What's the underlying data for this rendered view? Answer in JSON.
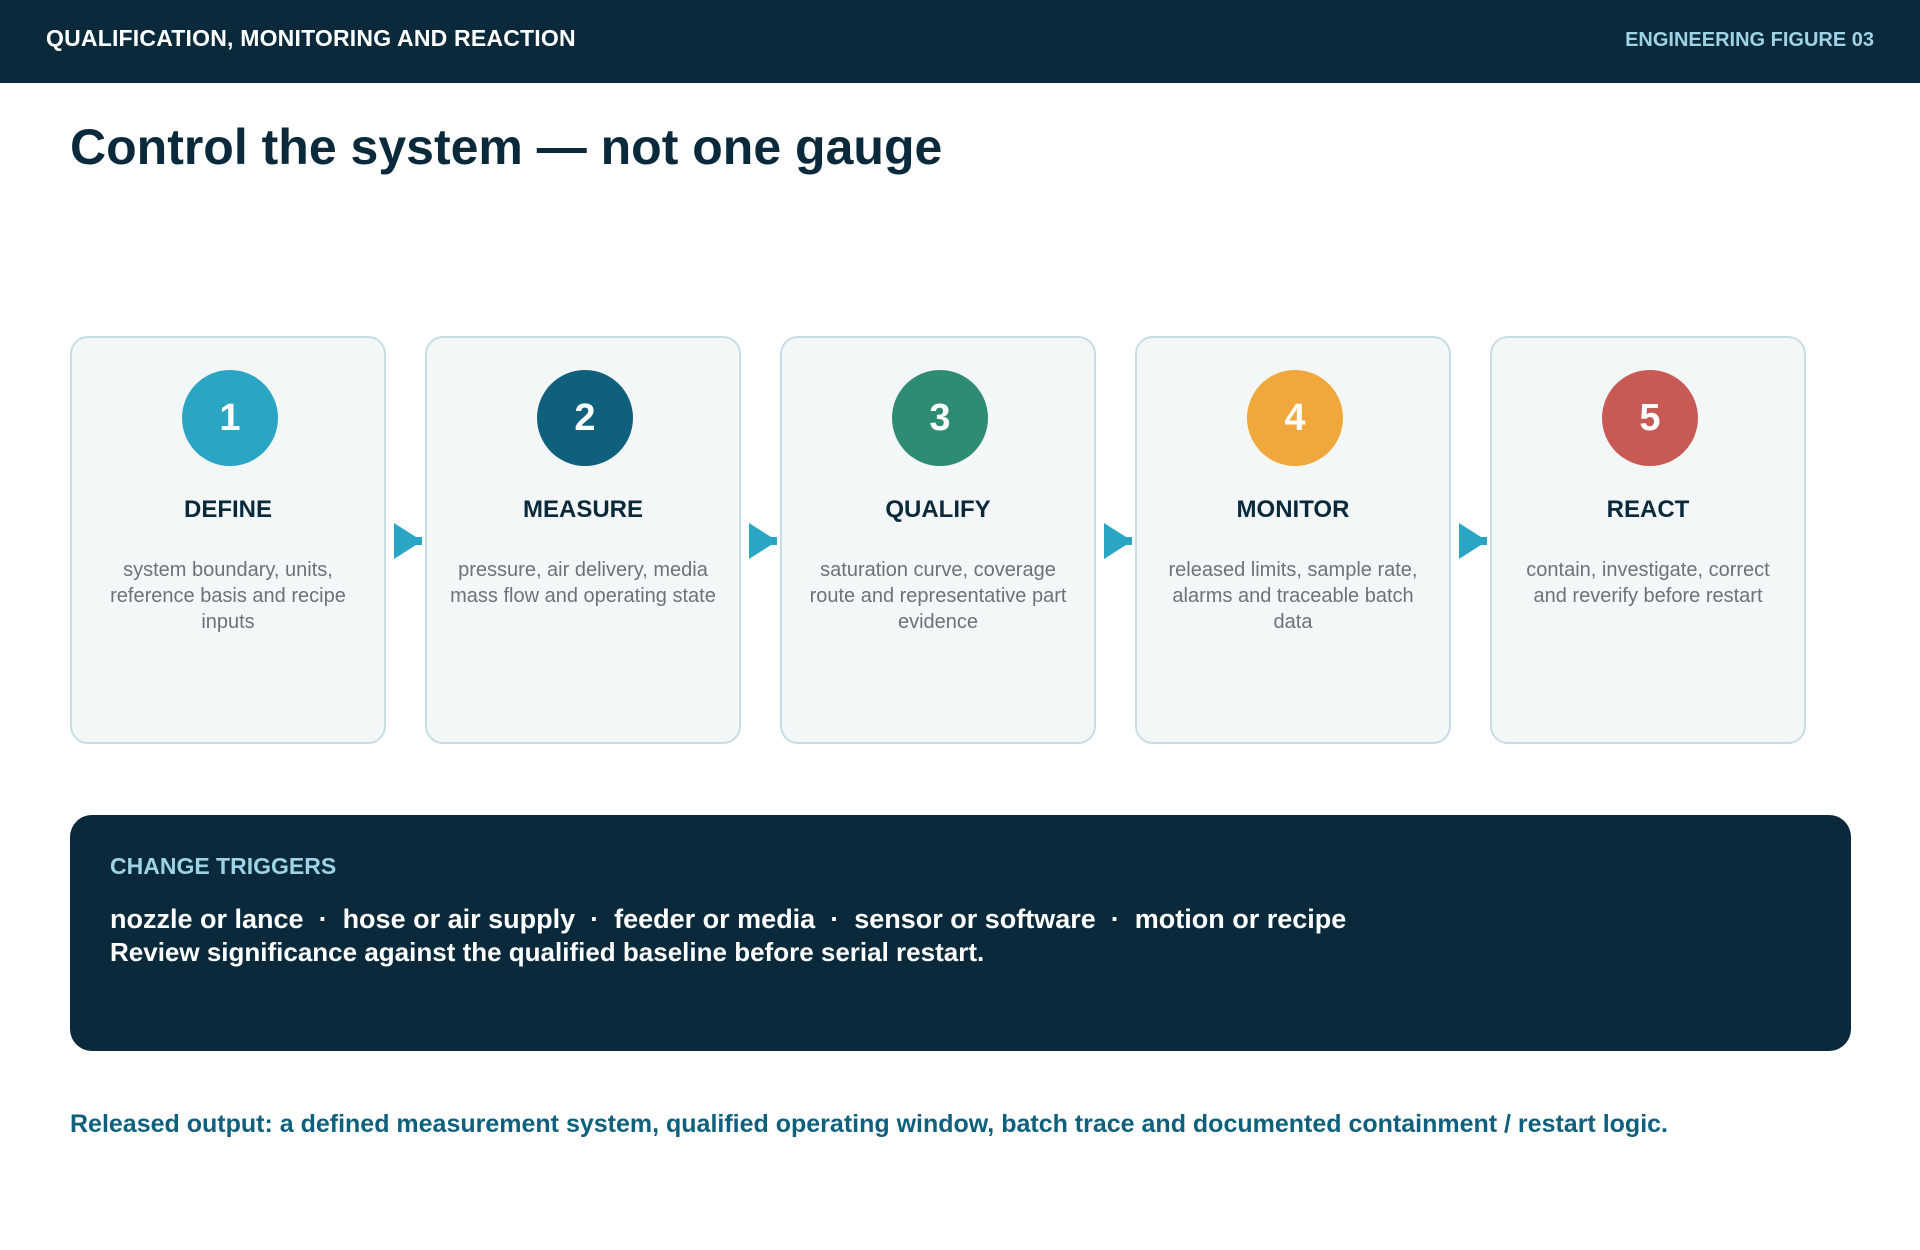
{
  "header": {
    "title": "QUALIFICATION, MONITORING AND REACTION",
    "figure_label": "ENGINEERING FIGURE 03"
  },
  "page_title": "Control the system — not one gauge",
  "steps": [
    {
      "number": "1",
      "title": "DEFINE",
      "description": "system boundary, units, reference basis and recipe inputs",
      "color": "#2aa5c4"
    },
    {
      "number": "2",
      "title": "MEASURE",
      "description": "pressure, air delivery, media mass flow and operating state",
      "color": "#0f607c"
    },
    {
      "number": "3",
      "title": "QUALIFY",
      "description": "saturation curve, coverage route and representative part evidence",
      "color": "#2e8b74"
    },
    {
      "number": "4",
      "title": "MONITOR",
      "description": "released limits, sample rate, alarms and traceable batch data",
      "color": "#f0a83c"
    },
    {
      "number": "5",
      "title": "REACT",
      "description": "contain, investigate, correct and reverify before restart",
      "color": "#c85a55"
    }
  ],
  "arrow_color": "#2aa5c4",
  "change_triggers": {
    "heading": "CHANGE TRIGGERS",
    "items": [
      "nozzle or lance",
      "hose or air supply",
      "feeder or media",
      "sensor or software",
      "motion or recipe"
    ],
    "separator": "  ·  ",
    "note": "Review significance against the qualified baseline before serial restart."
  },
  "footer_note": "Released output: a defined measurement system, qualified operating window, batch trace and documented containment / restart logic.",
  "colors": {
    "navy": "#0a2a3c",
    "accent_light": "#9dd3e4",
    "footer_text": "#0f607c",
    "card_bg": "#f3f7f8",
    "card_border": "#c6dde4"
  }
}
